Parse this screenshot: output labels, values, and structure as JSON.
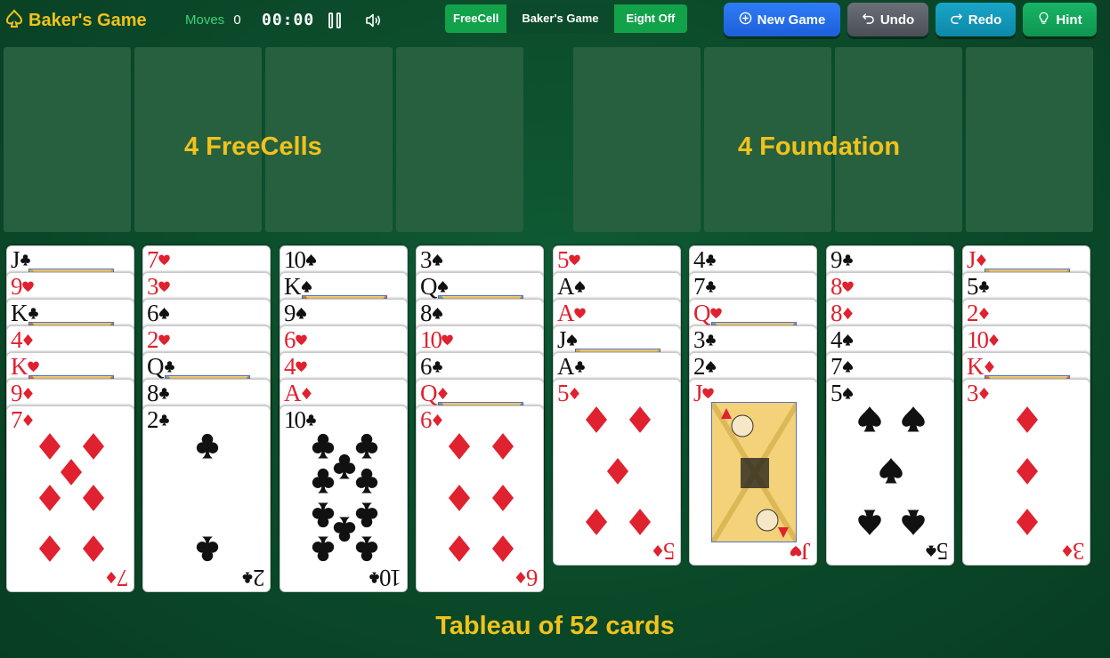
{
  "header": {
    "title": "Baker's Game",
    "moves_label": "Moves",
    "moves_value": "0",
    "timer": "00:00",
    "variants": [
      "FreeCell",
      "Baker's Game",
      "Eight Off"
    ],
    "active_variant": "Baker's Game",
    "buttons": {
      "new_game": "New Game",
      "undo": "Undo",
      "redo": "Redo",
      "hint": "Hint"
    }
  },
  "labels": {
    "freecells": "4 FreeCells",
    "foundation": "4 Foundation",
    "tableau": "Tableau of 52 cards"
  },
  "colors": {
    "felt": "#0b4a2a",
    "slot": "#27603f",
    "label": "#f1c21b",
    "red_suit": "#e0212f",
    "black_suit": "#111111"
  },
  "tableau": [
    {
      "column": 1,
      "cards": [
        {
          "rank": "J",
          "suit": "clubs"
        },
        {
          "rank": "9",
          "suit": "hearts"
        },
        {
          "rank": "K",
          "suit": "clubs"
        },
        {
          "rank": "4",
          "suit": "diamonds"
        },
        {
          "rank": "K",
          "suit": "hearts"
        },
        {
          "rank": "9",
          "suit": "diamonds"
        },
        {
          "rank": "7",
          "suit": "diamonds"
        }
      ]
    },
    {
      "column": 2,
      "cards": [
        {
          "rank": "7",
          "suit": "hearts"
        },
        {
          "rank": "3",
          "suit": "hearts"
        },
        {
          "rank": "6",
          "suit": "spades"
        },
        {
          "rank": "2",
          "suit": "hearts"
        },
        {
          "rank": "Q",
          "suit": "clubs"
        },
        {
          "rank": "8",
          "suit": "clubs"
        },
        {
          "rank": "2",
          "suit": "clubs"
        }
      ]
    },
    {
      "column": 3,
      "cards": [
        {
          "rank": "10",
          "suit": "spades"
        },
        {
          "rank": "K",
          "suit": "spades"
        },
        {
          "rank": "9",
          "suit": "spades"
        },
        {
          "rank": "6",
          "suit": "hearts"
        },
        {
          "rank": "4",
          "suit": "hearts"
        },
        {
          "rank": "A",
          "suit": "diamonds"
        },
        {
          "rank": "10",
          "suit": "clubs"
        }
      ]
    },
    {
      "column": 4,
      "cards": [
        {
          "rank": "3",
          "suit": "spades"
        },
        {
          "rank": "Q",
          "suit": "spades"
        },
        {
          "rank": "8",
          "suit": "spades"
        },
        {
          "rank": "10",
          "suit": "hearts"
        },
        {
          "rank": "6",
          "suit": "clubs"
        },
        {
          "rank": "Q",
          "suit": "diamonds"
        },
        {
          "rank": "6",
          "suit": "diamonds"
        }
      ]
    },
    {
      "column": 5,
      "cards": [
        {
          "rank": "5",
          "suit": "hearts"
        },
        {
          "rank": "A",
          "suit": "spades"
        },
        {
          "rank": "A",
          "suit": "hearts"
        },
        {
          "rank": "J",
          "suit": "spades"
        },
        {
          "rank": "A",
          "suit": "clubs"
        },
        {
          "rank": "5",
          "suit": "diamonds"
        }
      ]
    },
    {
      "column": 6,
      "cards": [
        {
          "rank": "4",
          "suit": "clubs"
        },
        {
          "rank": "7",
          "suit": "clubs"
        },
        {
          "rank": "Q",
          "suit": "hearts"
        },
        {
          "rank": "3",
          "suit": "clubs"
        },
        {
          "rank": "2",
          "suit": "spades"
        },
        {
          "rank": "J",
          "suit": "hearts"
        }
      ]
    },
    {
      "column": 7,
      "cards": [
        {
          "rank": "9",
          "suit": "clubs"
        },
        {
          "rank": "8",
          "suit": "hearts"
        },
        {
          "rank": "8",
          "suit": "diamonds"
        },
        {
          "rank": "4",
          "suit": "spades"
        },
        {
          "rank": "7",
          "suit": "spades"
        },
        {
          "rank": "5",
          "suit": "spades"
        }
      ]
    },
    {
      "column": 8,
      "cards": [
        {
          "rank": "J",
          "suit": "diamonds"
        },
        {
          "rank": "5",
          "suit": "clubs"
        },
        {
          "rank": "2",
          "suit": "diamonds"
        },
        {
          "rank": "10",
          "suit": "diamonds"
        },
        {
          "rank": "K",
          "suit": "diamonds"
        },
        {
          "rank": "3",
          "suit": "diamonds"
        }
      ]
    }
  ]
}
